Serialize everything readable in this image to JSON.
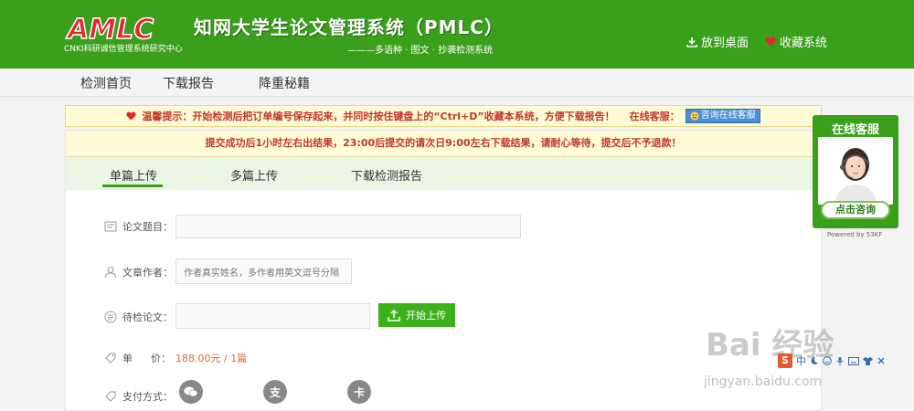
{
  "header": {
    "logo_sub": "CNKI科研诚信管理系统研究中心",
    "title": "知网大学生论文管理系统（PMLC）",
    "subtitle": "———多语种 · 图文 · 抄袭检测系统",
    "actions": [
      {
        "label": "放到桌面",
        "icon": "download-icon"
      },
      {
        "label": "收藏系统",
        "icon": "heart-icon"
      }
    ]
  },
  "nav": {
    "items": [
      "检测首页",
      "下载报告",
      "降重秘籍"
    ]
  },
  "notice": {
    "text": "温馨提示：开始检测后把订单编号保存起来，并同时按住键盘上的“Ctrl+D”收藏本系统，方便下载报告！",
    "service_label": "在线客服：",
    "service_button": "咨询在线客服"
  },
  "panel": {
    "message": "提交成功后1小时左右出结果，23:00后提交的请次日9:00左右下载结果，请耐心等待，提交后不予退款！",
    "tabs": [
      "单篇上传",
      "多篇上传",
      "下载检测报告"
    ],
    "active_tab": 0,
    "form": {
      "title_label": "论文题目：",
      "title_value": "",
      "author_label": "文章作者：",
      "author_placeholder": "作者真实姓名，多作者用英文逗号分隔",
      "paper_label": "待检论文：",
      "upload_button": "开始上传",
      "price_label_1": "单",
      "price_label_2": "价：",
      "price_value": "188.00元 / 1篇",
      "pay_label": "支付方式："
    }
  },
  "widget": {
    "title": "在线客服",
    "button": "点击咨询",
    "powered": "Powered by 53KF"
  },
  "watermark": {
    "main": "Bai 经验",
    "url": "jingyan.baidu.com"
  },
  "ime": {
    "s": "S",
    "text": "中"
  },
  "colors": {
    "brand_green": "#3aa01c",
    "warning_red": "#c0392b",
    "price_orange": "#d96a2e"
  }
}
